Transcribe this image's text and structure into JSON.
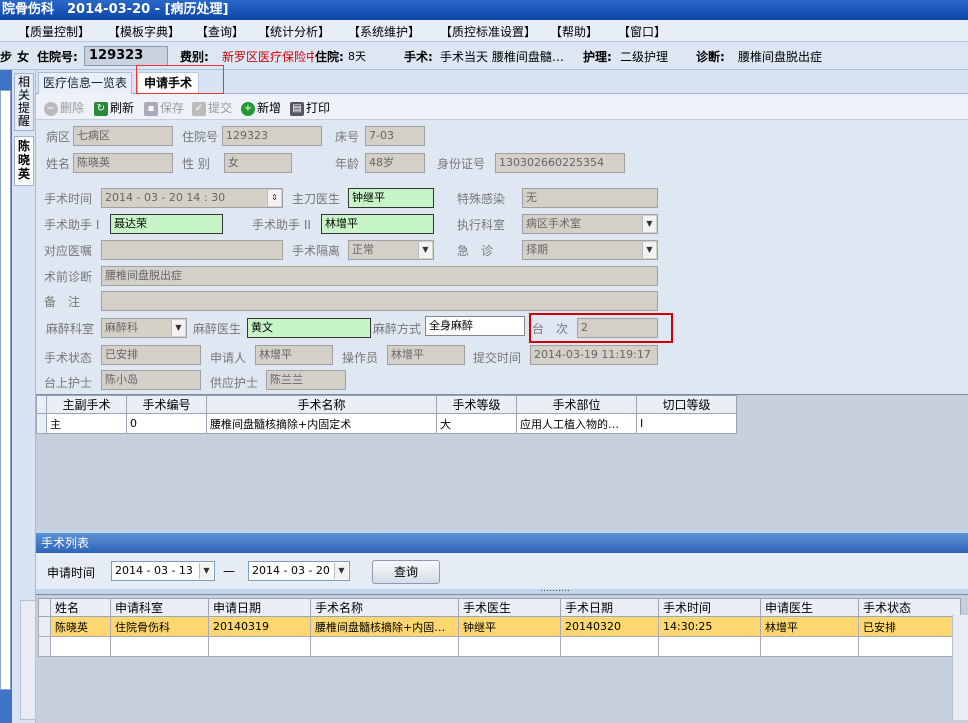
{
  "window": {
    "title": "院骨伤科　2014-03-20 - [病历处理]"
  },
  "menu": [
    "【质量控制】",
    "【模板字典】",
    "【查询】",
    "【统计分析】",
    "【系统维护】",
    "【质控标准设置】",
    "【帮助】",
    "【窗口】"
  ],
  "patient_bar": {
    "gender_prefix": "步",
    "gender": "女",
    "admission_label": "住院号:",
    "admission_no": "129323",
    "fee_label": "费别:",
    "fee_value": "新罗区医疗保险中",
    "stay_label": "住院:",
    "stay_value": "8天",
    "surgery_label": "手术:",
    "surgery_value": "手术当天  腰椎间盘髓…",
    "nursing_label": "护理:",
    "nursing_value": "二级护理",
    "diag_label": "诊断:",
    "diag_value": "腰椎间盘脱出症"
  },
  "side_tabs": {
    "reminder": "相关提醒",
    "patient": "陈晓英"
  },
  "tabs": {
    "list": "医疗信息一览表",
    "apply": "申请手术"
  },
  "toolbar": {
    "delete": "删除",
    "refresh": "刷新",
    "save": "保存",
    "submit": "提交",
    "new": "新增",
    "print": "打印"
  },
  "form": {
    "ward_label": "病区",
    "ward": "七病区",
    "admno_label": "住院号",
    "admno": "129323",
    "bed_label": "床号",
    "bed": "7-03",
    "name_label": "姓名",
    "name": "陈晓英",
    "sex_label": "性 别",
    "sex": "女",
    "age_label": "年龄",
    "age": "48岁",
    "id_label": "身份证号",
    "id": "130302660225354",
    "op_time_label": "手术时间",
    "op_time": "2014 - 03 - 20   14 : 30",
    "surgeon_label": "主刀医生",
    "surgeon": "钟继平",
    "infect_label": "特殊感染",
    "infect": "无",
    "asst1_label": "手术助手 I",
    "asst1": "聂达荣",
    "asst2_label": "手术助手 II",
    "asst2": "林增平",
    "exec_label": "执行科室",
    "exec": "病区手术室",
    "order_label": "对应医嘱",
    "order": "",
    "iso_label": "手术隔离",
    "iso": "正常",
    "emerg_label": "急　诊",
    "emerg": "择期",
    "prediag_label": "术前诊断",
    "prediag": "腰椎间盘脱出症",
    "note_label": "备　注",
    "note": "",
    "anes_dept_label": "麻醉科室",
    "anes_dept": "麻醉科",
    "anes_doc_label": "麻醉医生",
    "anes_doc": "黄文",
    "anes_method_label": "麻醉方式",
    "anes_method": "全身麻醉",
    "count_label": "台　次",
    "count": "2",
    "status_label": "手术状态",
    "status": "已安排",
    "applicant_label": "申请人",
    "applicant": "林增平",
    "operator_label": "操作员",
    "operator": "林增平",
    "submit_time_label": "提交时间",
    "submit_time": "2014-03-19 11:19:17",
    "nurse_label": "台上护士",
    "nurse": "陈小岛",
    "supply_label": "供应护士",
    "supply": "陈兰兰"
  },
  "op_table": {
    "headers": [
      "主副手术",
      "手术编号",
      "手术名称",
      "手术等级",
      "手术部位",
      "切口等级"
    ],
    "rows": [
      [
        "主",
        "0",
        "腰椎间盘髓核摘除+内固定术",
        "大",
        "应用人工植入物的…",
        "I"
      ]
    ]
  },
  "op_list": {
    "title": "手术列表",
    "date_label": "申请时间",
    "date_from": "2014 - 03 - 13",
    "dash": "—",
    "date_to": "2014 - 03 - 20",
    "query": "查询",
    "dots": "……….",
    "headers": [
      "姓名",
      "申请科室",
      "申请日期",
      "手术名称",
      "手术医生",
      "手术日期",
      "手术时间",
      "申请医生",
      "手术状态"
    ],
    "rows": [
      [
        "陈晓英",
        "住院骨伤科",
        "20140319",
        "腰椎间盘髓核摘除+内固…",
        "钟继平",
        "20140320",
        "14:30:25",
        "林增平",
        "已安排"
      ]
    ]
  }
}
